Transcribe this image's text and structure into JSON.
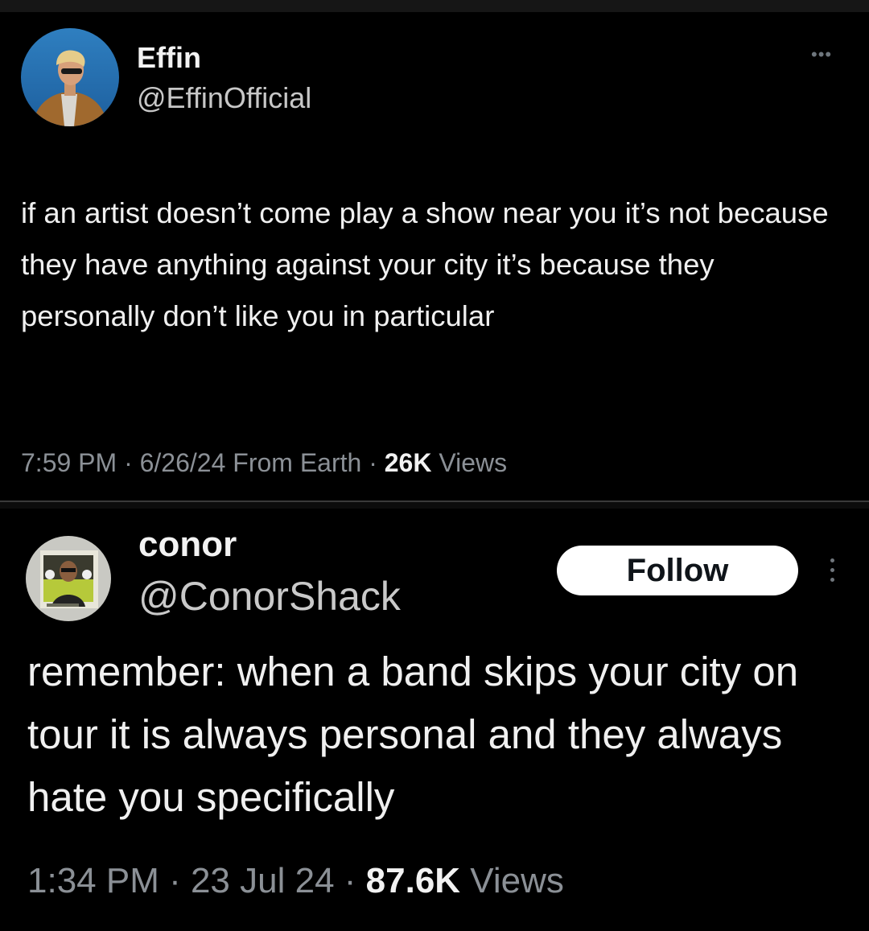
{
  "tweets": [
    {
      "author_name": "Effin",
      "author_handle": "@EffinOfficial",
      "more_icon": "more-horizontal-icon",
      "text": "if an artist doesn’t come play a show near you it’s not because they have anything against your city it’s because they personally don’t like you in particular",
      "timestamp": "7:59 PM · 6/26/24 From Earth · ",
      "views_count": "26K",
      "views_label": " Views"
    },
    {
      "author_name": "conor",
      "author_handle": "@ConorShack",
      "follow_label": "Follow",
      "more_icon": "more-vertical-icon",
      "text": "remember: when a band skips your city on tour it is always personal and they always hate you specifically",
      "timestamp": "1:34 PM · 23 Jul 24 · ",
      "views_count": "87.6K",
      "views_label": " Views"
    }
  ],
  "colors": {
    "background": "#000000",
    "text_primary": "#e7e9ea",
    "text_secondary": "#8b9096",
    "follow_button_bg": "#ffffff"
  }
}
